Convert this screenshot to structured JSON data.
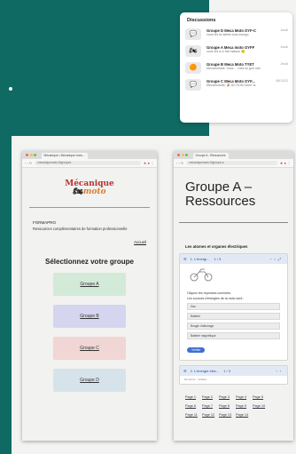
{
  "discussions": {
    "title": "Discussions",
    "chats": [
      {
        "icon": "💬",
        "name": "Groupe D Meca Moto OYF-C",
        "time": "Jeudi",
        "msg": "vous les ta labels tous bourgo"
      },
      {
        "icon": "🏍",
        "name": "Groupe A Meca moto OYFF",
        "time": "Jeudi",
        "msg": "vous les a ci fait maison 😊"
      },
      {
        "icon": "🟠",
        "name": "Groupe B Meca Moto TYET",
        "time": "Jeudi",
        "msg": "Mecamotobk: Vous ... mes ils gon une"
      },
      {
        "icon": "💬",
        "name": "Groupe C Meca Moto OYF...",
        "time": "08/11/22",
        "msg": "Mecamotobk: 🎉 ACTION Gerer la"
      }
    ]
  },
  "window_a": {
    "tab": "Mécanique • Mécanique moto...",
    "url": "mecaniquemoto.fr/groupes",
    "logo_top": "Mécanique",
    "logo_bottom": "moto",
    "org": "FORMAPRO",
    "org_desc": "Ressources complémentaires de formation professionnelle",
    "accueil": "Accueil",
    "heading": "Sélectionnez votre groupe",
    "groups": [
      "Groupe A",
      "Groupe B",
      "Groupe C",
      "Groupe D"
    ],
    "group_colors": [
      "#d3ead8",
      "#d6d5ef",
      "#f0d6d4",
      "#d6e3eb"
    ]
  },
  "window_b": {
    "tab": "Groupe A - Ressources",
    "url": "mecaniquemoto.fr/groupe-a",
    "title": "Groupe A – Ressources",
    "section": "Les atomes et organes électriques",
    "card1": {
      "label": "1. L'énergi...",
      "count": "1 / 3",
      "question": "Cliquez les réponses correctes",
      "prompt": "Les sources d'énergies de la moto sont :",
      "options": [
        "Gaz",
        "Batterie",
        "Bougie d'allumage",
        "Batterie magnétique"
      ],
      "button": "Vérifier"
    },
    "card2": {
      "label": "2. L'énergie élec...",
      "count": "1 / 3",
      "sub": "Démarrer · Voltaire"
    },
    "pages": [
      "Page 1",
      "Page 2",
      "Page 3",
      "Page 4",
      "Page 5",
      "Page 6",
      "Page 7",
      "Page 8",
      "Page 9",
      "Page 10",
      "Page 11",
      "Page 12",
      "Page 13",
      "Page 14"
    ]
  }
}
